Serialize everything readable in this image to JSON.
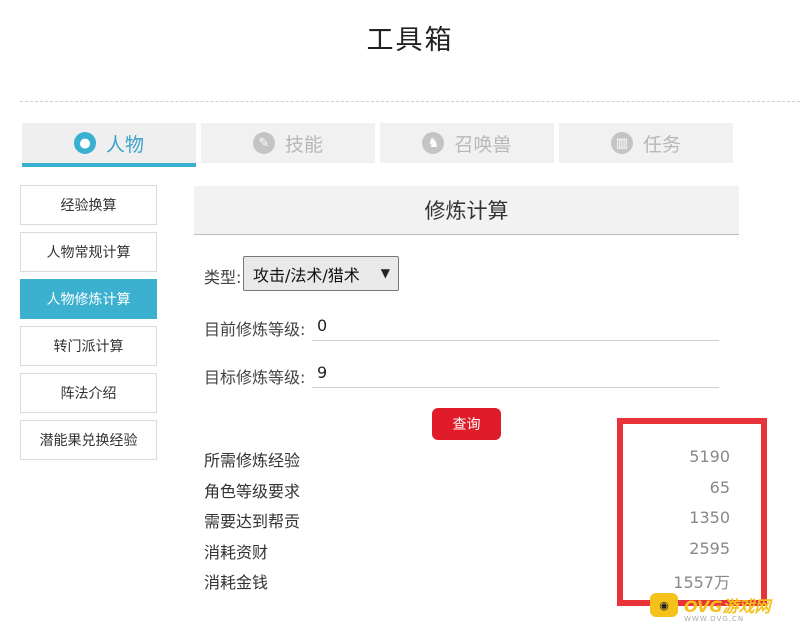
{
  "title": "工具箱",
  "tabs": [
    {
      "label": "人物",
      "icon": "person-icon"
    },
    {
      "label": "技能",
      "icon": "skill-icon"
    },
    {
      "label": "召唤兽",
      "icon": "pet-icon"
    },
    {
      "label": "任务",
      "icon": "book-icon"
    }
  ],
  "sidebar": {
    "items": [
      {
        "label": "经验换算"
      },
      {
        "label": "人物常规计算"
      },
      {
        "label": "人物修炼计算"
      },
      {
        "label": "转门派计算"
      },
      {
        "label": "阵法介绍"
      },
      {
        "label": "潜能果兑换经验"
      }
    ],
    "active": "人物修炼计算"
  },
  "panel": {
    "heading": "修炼计算",
    "type_label": "类型:",
    "type_value": "攻击/法术/猎术",
    "current_label": "目前修炼等级:",
    "current_value": "0",
    "target_label": "目标修炼等级:",
    "target_value": "9",
    "query_button": "查询"
  },
  "results": [
    {
      "label": "所需修炼经验",
      "value": "5190"
    },
    {
      "label": "角色等级要求",
      "value": "65"
    },
    {
      "label": "需要达到帮贡",
      "value": "1350"
    },
    {
      "label": "消耗资财",
      "value": "2595"
    },
    {
      "label": "消耗金钱",
      "value": "1557万"
    }
  ],
  "watermark": {
    "text": "OVG游戏网",
    "sub": "WWW.OVG.CN"
  },
  "colors": {
    "accent": "#3ab0d0",
    "button": "#e01c2a",
    "highlight_box": "#e8333a"
  }
}
